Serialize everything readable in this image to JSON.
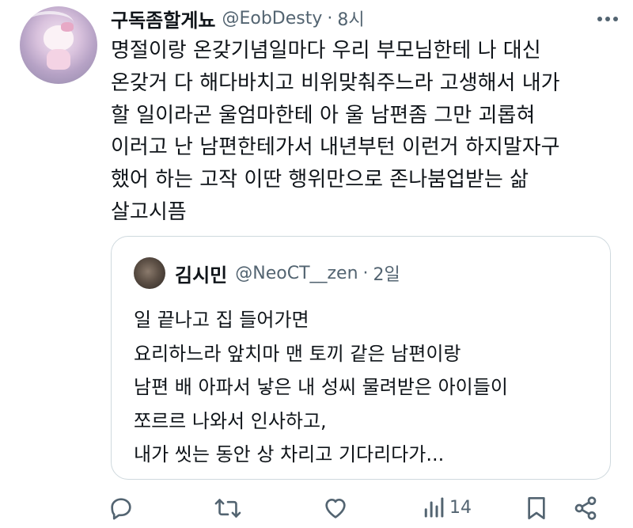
{
  "tweet": {
    "display_name": "구독좀할게뇨",
    "handle": "@EobDesty",
    "separator": "·",
    "time": "8시",
    "lines": [
      "명절이랑 온갖기념일마다 우리 부모님한테 나 대신",
      "온갖거 다 해다바치고 비위맞춰주느라 고생해서 내가",
      "할 일이라곤 울엄마한테 아 울 남편좀 그만 괴롭혀",
      "이러고 난 남편한테가서 내년부턴 이런거 하지말자구",
      "했어 하는 고작 이딴 행위만으로 존나붐업받는 삶",
      "살고시픔"
    ]
  },
  "quote": {
    "display_name": "김시민",
    "handle": "@NeoCT__zen",
    "separator": "·",
    "time": "2일",
    "lines": [
      "일 끝나고 집 들어가면",
      "요리하느라 앞치마 맨 토끼 같은 남편이랑",
      "남편 배 아파서 낳은 내 성씨 물려받은 아이들이",
      "쪼르르 나와서 인사하고,",
      "내가 씻는 동안 상 차리고 기다리다가..."
    ]
  },
  "actions": {
    "views_count": "14",
    "icons": [
      "reply-icon",
      "retweet-icon",
      "like-icon",
      "views-icon",
      "bookmark-icon",
      "share-icon"
    ]
  },
  "colors": {
    "text": "#0f1419",
    "muted": "#536471",
    "border": "#cfd9de"
  }
}
